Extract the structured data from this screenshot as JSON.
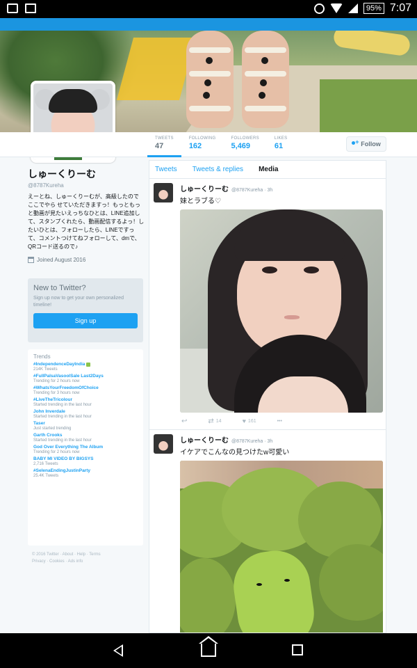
{
  "status_bar": {
    "time": "7:07",
    "battery": "95%",
    "icons": [
      "incognito-icon",
      "image-icon",
      "circle-status-icon",
      "wifi-icon",
      "signal-icon",
      "battery-icon"
    ]
  },
  "profile": {
    "display_name": "しゅーくりーむ",
    "handle": "@8787Kureha",
    "bio": "えーとね、しゅーくりーむが、高級したので ここでやら せていただきますっ！もっともっと動画が見たいえっちなひとは、LINE追加して、スタンプくれたら、動画配信するよっ！したいひとは、フォローしたら、LINEですって、コメントつけてねフォローして、dmで、QRコード送るので♪",
    "joined": "Joined August 2016"
  },
  "stats": [
    {
      "label": "TWEETS",
      "value": "47"
    },
    {
      "label": "FOLLOWING",
      "value": "162"
    },
    {
      "label": "FOLLOWERS",
      "value": "5,469"
    },
    {
      "label": "LIKES",
      "value": "61"
    }
  ],
  "follow_label": "Follow",
  "new_to_twitter": {
    "title": "New to Twitter?",
    "subtitle": "Sign up now to get your own personalized timeline!",
    "button": "Sign up"
  },
  "trends": {
    "title": "Trends",
    "items": [
      {
        "name": "#IndependenceDayIndia",
        "meta": "214K Tweets"
      },
      {
        "name": "#FullPalsaVasoolSale Last2Days",
        "meta": "Trending for 2 hours now"
      },
      {
        "name": "#WhatsYourFreedomOfChoice",
        "meta": "Trending for 3 hours now"
      },
      {
        "name": "#LiveTheTricolour",
        "meta": "Started trending in the last hour"
      },
      {
        "name": "John Inverdale",
        "meta": "Started trending in the last hour"
      },
      {
        "name": "Taser",
        "meta": "Just started trending"
      },
      {
        "name": "Garth Crooks",
        "meta": "Started trending in the last hour"
      },
      {
        "name": "God Over Everything The Album",
        "meta": "Trending for 2 hours now"
      },
      {
        "name": "BABY MI VIDEO BY BIGSYS",
        "meta": "2,716 Tweets"
      },
      {
        "name": "#SelenaEndingJustinParty",
        "meta": "25.4K Tweets"
      }
    ]
  },
  "footer": {
    "line1": "© 2016 Twitter · About · Help · Terms",
    "line2": "Privacy · Cookies · Ads info"
  },
  "timeline": {
    "tabs": [
      "Tweets",
      "Tweets & replies",
      "Media"
    ],
    "tweets": [
      {
        "name": "しゅーくりーむ",
        "handle": "@8787Kureha · 3h",
        "text": "妹とラブる♡",
        "retweets": "14",
        "likes": "161"
      },
      {
        "name": "しゅーくりーむ",
        "handle": "@8787Kureha · 3h",
        "text": "イケアでこんなの見つけたw可愛い"
      }
    ]
  },
  "colors": {
    "accent": "#1da1f2",
    "stripe": "#1b95e0",
    "background": "#f5f8fa"
  }
}
